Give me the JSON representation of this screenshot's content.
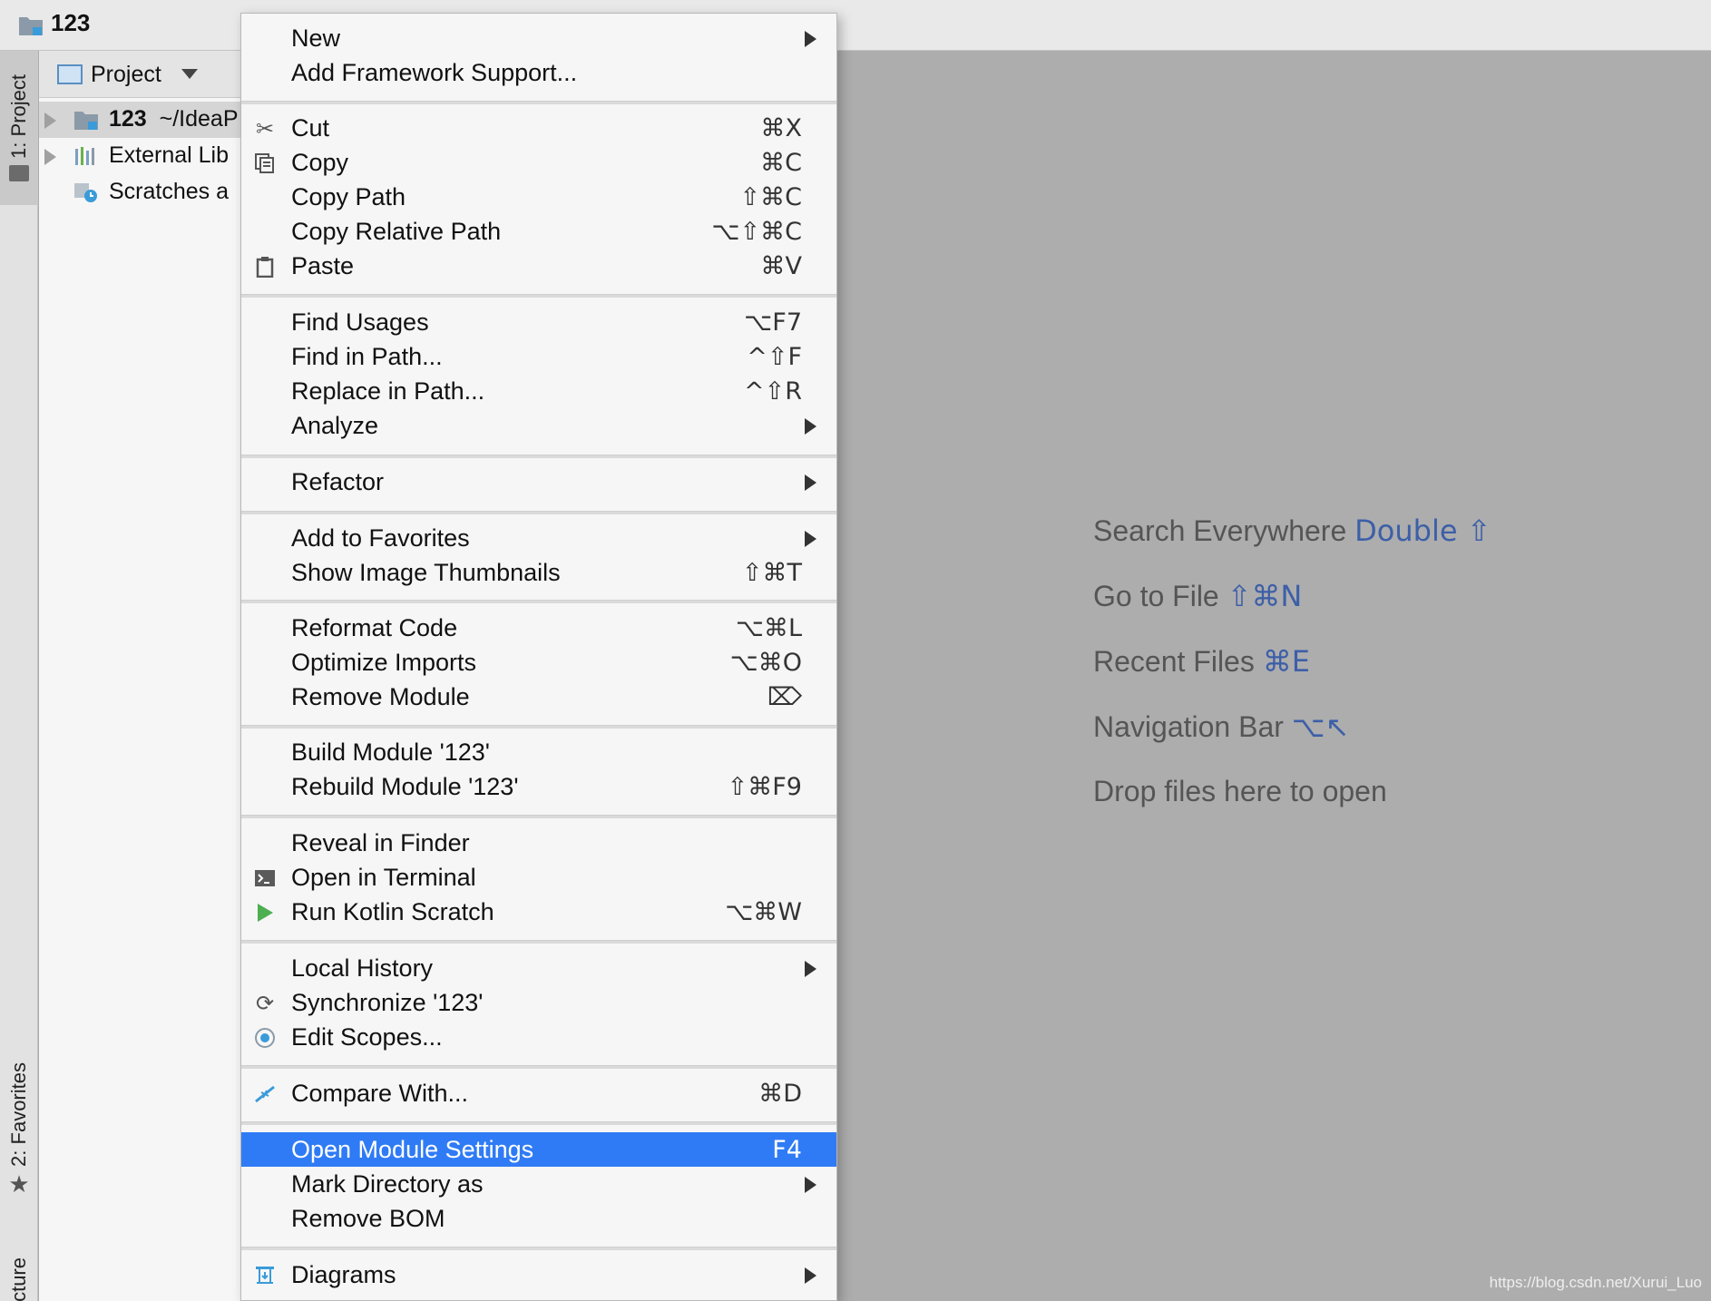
{
  "window": {
    "title": "123"
  },
  "toolstrip": {
    "project_tab": "1: Project",
    "favorites_tab": "2: Favorites",
    "structure_tab": "Structure"
  },
  "project_panel": {
    "view_label": "Project",
    "tree": [
      {
        "name": "123",
        "path": "~/IdeaP"
      },
      {
        "name": "External Lib"
      },
      {
        "name": "Scratches a"
      }
    ]
  },
  "context_menu": {
    "items": [
      {
        "label": "New",
        "shortcut": "",
        "submenu": true
      },
      {
        "label": "Add Framework Support...",
        "shortcut": ""
      },
      {
        "label": "Cut",
        "shortcut": "⌘X",
        "icon": "scissors-icon"
      },
      {
        "label": "Copy",
        "shortcut": "⌘C",
        "icon": "copy-icon"
      },
      {
        "label": "Copy Path",
        "shortcut": "⇧⌘C"
      },
      {
        "label": "Copy Relative Path",
        "shortcut": "⌥⇧⌘C"
      },
      {
        "label": "Paste",
        "shortcut": "⌘V",
        "icon": "clipboard-icon"
      },
      {
        "label": "Find Usages",
        "shortcut": "⌥F7"
      },
      {
        "label": "Find in Path...",
        "shortcut": "^⇧F"
      },
      {
        "label": "Replace in Path...",
        "shortcut": "^⇧R"
      },
      {
        "label": "Analyze",
        "shortcut": "",
        "submenu": true
      },
      {
        "label": "Refactor",
        "shortcut": "",
        "submenu": true
      },
      {
        "label": "Add to Favorites",
        "shortcut": "",
        "submenu": true
      },
      {
        "label": "Show Image Thumbnails",
        "shortcut": "⇧⌘T"
      },
      {
        "label": "Reformat Code",
        "shortcut": "⌥⌘L"
      },
      {
        "label": "Optimize Imports",
        "shortcut": "⌥⌘O"
      },
      {
        "label": "Remove Module",
        "shortcut": "⌦"
      },
      {
        "label": "Build Module '123'",
        "shortcut": ""
      },
      {
        "label": "Rebuild Module '123'",
        "shortcut": "⇧⌘F9"
      },
      {
        "label": "Reveal in Finder",
        "shortcut": ""
      },
      {
        "label": "Open in Terminal",
        "shortcut": "",
        "icon": "terminal-icon"
      },
      {
        "label": "Run Kotlin Scratch",
        "shortcut": "⌥⌘W",
        "icon": "run-icon"
      },
      {
        "label": "Local History",
        "shortcut": "",
        "submenu": true
      },
      {
        "label": "Synchronize '123'",
        "shortcut": "",
        "icon": "sync-icon"
      },
      {
        "label": "Edit Scopes...",
        "shortcut": "",
        "icon": "scope-icon"
      },
      {
        "label": "Compare With...",
        "shortcut": "⌘D",
        "icon": "compare-icon"
      },
      {
        "label": "Open Module Settings",
        "shortcut": "F4",
        "highlighted": true
      },
      {
        "label": "Mark Directory as",
        "shortcut": "",
        "submenu": true
      },
      {
        "label": "Remove BOM",
        "shortcut": ""
      },
      {
        "label": "Diagrams",
        "shortcut": "",
        "submenu": true,
        "icon": "diagram-icon"
      }
    ]
  },
  "editor_hints": [
    {
      "text": "Search Everywhere",
      "key": "Double ⇧"
    },
    {
      "text": "Go to File",
      "key": "⇧⌘N"
    },
    {
      "text": "Recent Files",
      "key": "⌘E"
    },
    {
      "text": "Navigation Bar",
      "key": "⌥↖"
    },
    {
      "text": "Drop files here to open",
      "key": ""
    }
  ],
  "watermark": "https://blog.csdn.net/Xurui_Luo",
  "colors": {
    "highlight": "#2f7bf5",
    "hint_key": "#3d5fa8",
    "editor_bg": "#adadad"
  }
}
